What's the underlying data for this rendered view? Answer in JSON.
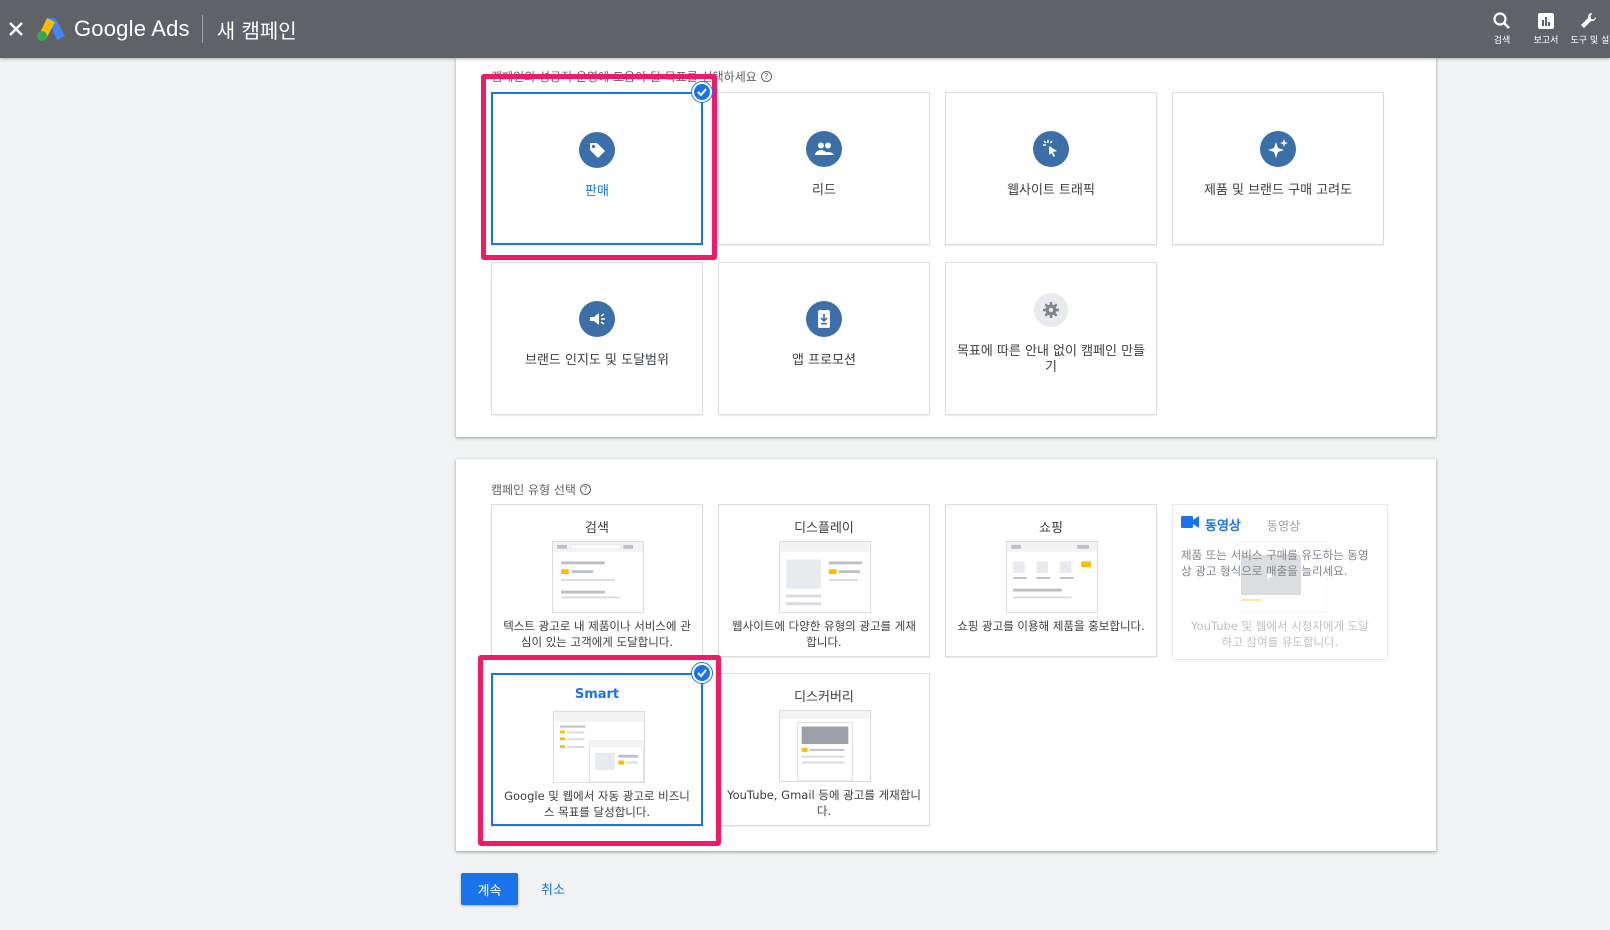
{
  "header": {
    "brand": "Google Ads",
    "page_title": "새 캠페인",
    "tools": [
      {
        "label": "검색",
        "icon": "search-icon"
      },
      {
        "label": "보고서",
        "icon": "reports-icon"
      },
      {
        "label": "도구 및 설정",
        "icon": "wrench-icon"
      }
    ]
  },
  "goals": {
    "label": "캠페인의 성공적 운영에 도움이 될 목표를 선택하세요",
    "items": [
      {
        "label": "판매",
        "icon": "tag-icon",
        "selected": true
      },
      {
        "label": "리드",
        "icon": "people-icon"
      },
      {
        "label": "웹사이트 트래픽",
        "icon": "cursor-click-icon"
      },
      {
        "label": "제품 및 브랜드 구매 고려도",
        "icon": "sparkle-icon"
      },
      {
        "label": "브랜드 인지도 및 도달범위",
        "icon": "speaker-icon"
      },
      {
        "label": "앱 프로모션",
        "icon": "phone-download-icon"
      },
      {
        "label": "목표에 따른 안내 없이 캠페인 만들기",
        "icon": "gear-icon"
      }
    ]
  },
  "campaign_types": {
    "label": "캠페인 유형 선택",
    "items": [
      {
        "title": "검색",
        "desc": "텍스트 광고로 내 제품이나 서비스에 관심이 있는 고객에게 도달합니다."
      },
      {
        "title": "디스플레이",
        "desc": "웹사이트에 다양한 유형의 광고를 게재합니다."
      },
      {
        "title": "쇼핑",
        "desc": "쇼핑 광고를 이용해 제품을 홍보합니다."
      },
      {
        "title": "동영상",
        "title_secondary": "동영상",
        "desc": "제품 또는 서비스 구매를 유도하는 동영상 광고 형식으로 매출을 늘리세요.",
        "desc_secondary": "YouTube 및 웹에서 시청자에게 도달하고 참여를 유도합니다.",
        "disabled": true
      },
      {
        "title": "Smart",
        "desc": "Google 및 웹에서 자동 광고로 비즈니스 목표를 달성합니다.",
        "selected": true
      },
      {
        "title": "디스커버리",
        "desc": "YouTube, Gmail 등에 광고를 게재합니다."
      }
    ]
  },
  "actions": {
    "continue": "계속",
    "cancel": "취소"
  },
  "colors": {
    "header_bg": "#5f6368",
    "accent": "#1a73e8",
    "highlight": "#f01a67",
    "goal_icon_bg": "#3c6ea8"
  }
}
